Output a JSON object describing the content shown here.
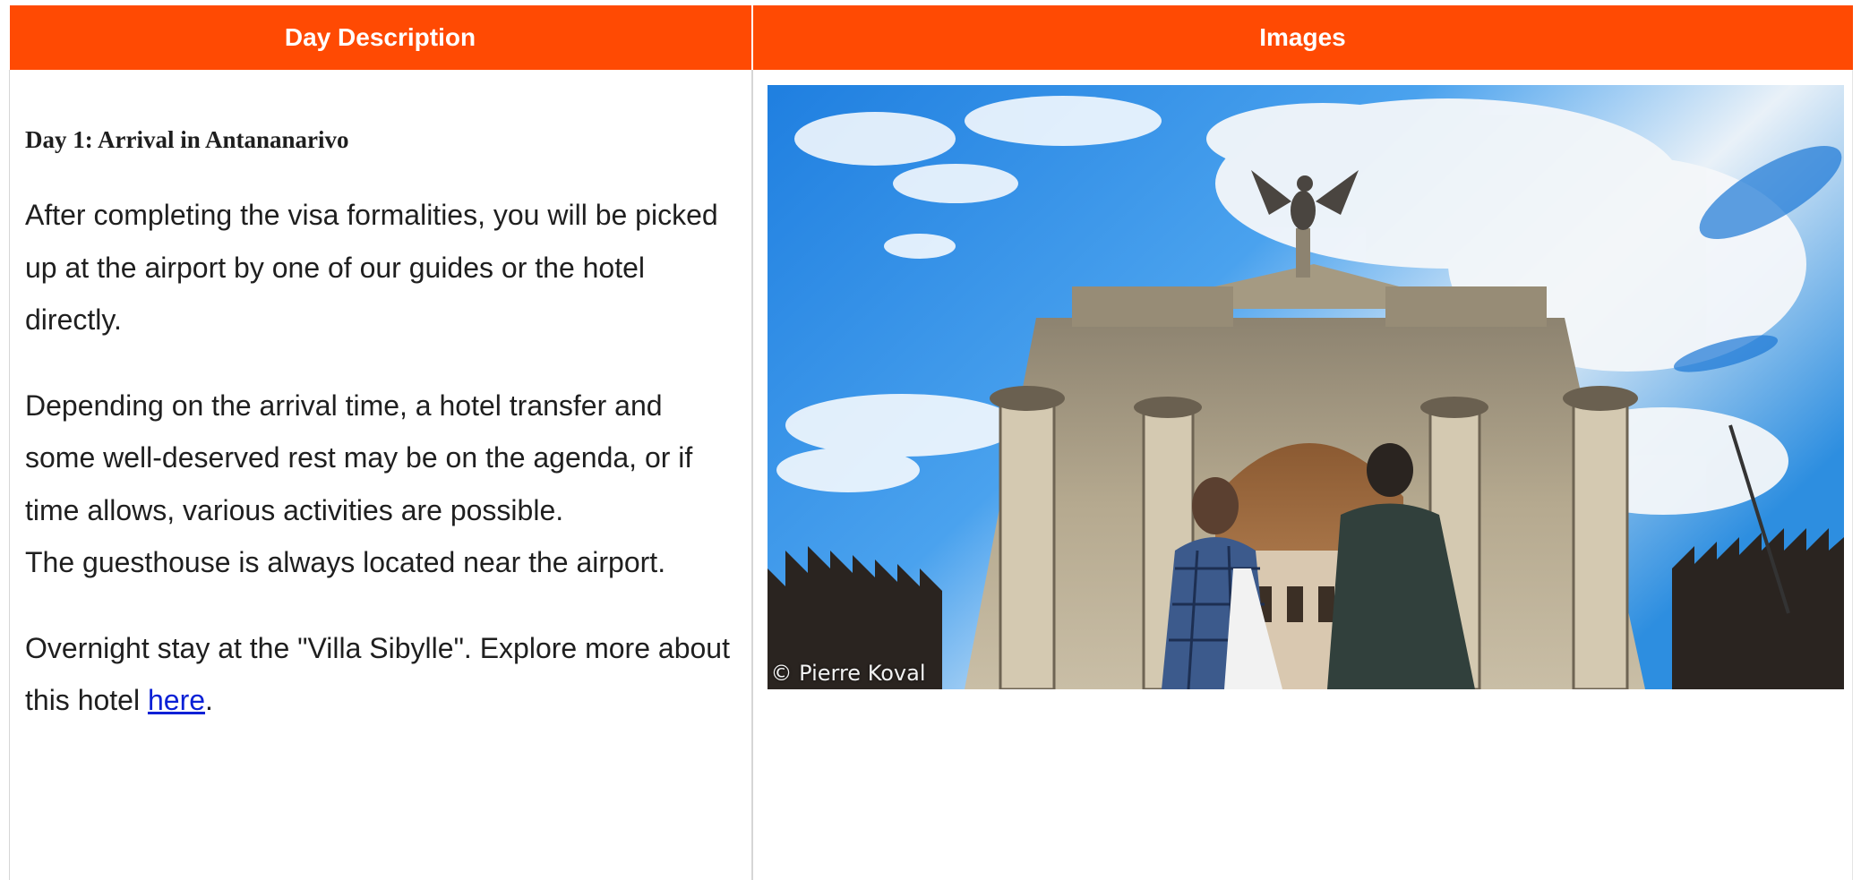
{
  "table": {
    "headers": {
      "description": "Day Description",
      "images": "Images"
    }
  },
  "day": {
    "title": "Day 1: Arrival in Antananarivo",
    "paragraph_1": "After completing the visa formalities, you will be picked up at the airport by one of our guides or the hotel directly.",
    "paragraph_2": "Depending on the arrival time, a hotel transfer and some well-deserved rest may be on the agenda, or if time allows, various activities are possible.",
    "paragraph_3": "The guesthouse is always located near the airport.",
    "paragraph_4_text": "Overnight stay at the \"Villa Sibylle\". Explore more about this hotel ",
    "paragraph_4_link": "here",
    "paragraph_4_end": "."
  },
  "photo": {
    "credit": "© Pierre Koval",
    "subject": "stone-arch-monument-with-eagle-statue"
  },
  "colors": {
    "header_bg": "#ff4a03",
    "header_text": "#ffffff",
    "link": "#0a21d6",
    "body_text": "#1f1f1f"
  }
}
